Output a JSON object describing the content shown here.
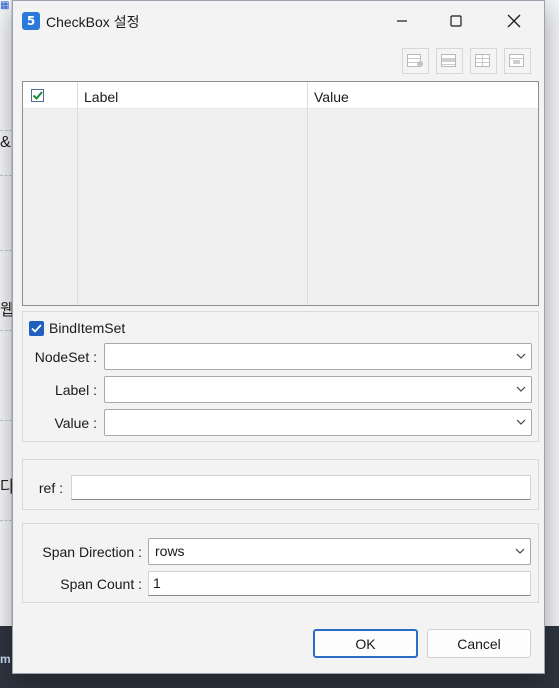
{
  "window": {
    "title": "CheckBox 설정",
    "app_icon_text": "5"
  },
  "background_app": {
    "left_glyphs": [
      "&",
      "웹",
      "다"
    ],
    "bottom_glyph": "m"
  },
  "grid": {
    "columns": [
      {
        "label": "",
        "type": "checkbox",
        "checked": true
      },
      {
        "label": "Label"
      },
      {
        "label": "Value"
      }
    ],
    "rows": []
  },
  "binditemset": {
    "checkbox_label": "BindItemSet",
    "checked": true,
    "nodeset_label": "NodeSet :",
    "nodeset_value": "",
    "label_label": "Label :",
    "label_value": "",
    "value_label": "Value :",
    "value_value": ""
  },
  "ref": {
    "label": "ref :",
    "value": ""
  },
  "span": {
    "direction_label": "Span Direction :",
    "direction_value": "rows",
    "count_label": "Span Count :",
    "count_value": "1"
  },
  "buttons": {
    "ok": "OK",
    "cancel": "Cancel"
  },
  "colors": {
    "accent": "#1f5fbf",
    "ok_border": "#2b6cc4"
  }
}
